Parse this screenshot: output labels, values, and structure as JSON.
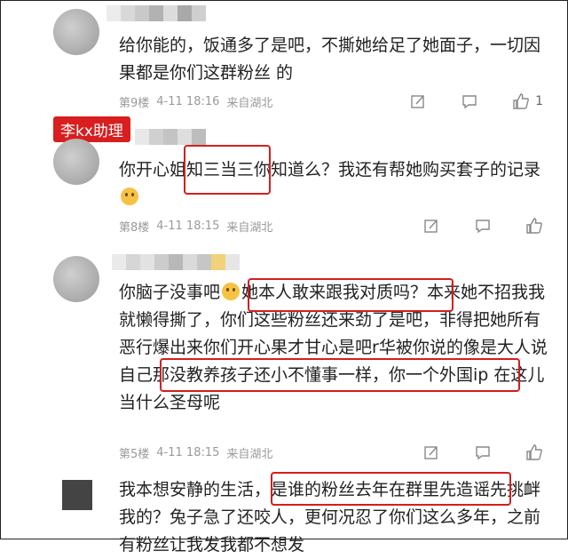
{
  "comments": [
    {
      "text": "给你能的，饭通多了是吧，不撕她给足了她面子，一切因果都是你们这群粉丝   的",
      "floor": "第9楼",
      "date": "4-11 18:16",
      "location": "来自湖北",
      "likes": "1"
    },
    {
      "tag": "李kx助理",
      "text_parts": [
        "你开心姐",
        "知三当三",
        "你知道么？我还有帮她购买套子的记录"
      ],
      "floor": "第8楼",
      "date": "4-11 18:15",
      "location": "来自湖北",
      "likes": ""
    },
    {
      "text_parts": [
        "你脑子没事吧",
        "她本人敢来跟我对质吗？",
        "本来她不招我我就懒得撕了，你们这些粉丝还来劲了是吧，非得把她所有恶行爆出来你们开心果才甘心是吧",
        "r华被你说的像是大人说自己那没教养孩子",
        "还小不懂事一样，你一个外国ip 在这儿当什么圣母呢"
      ],
      "floor": "第5楼",
      "date": "4-11 18:15",
      "location": "来自湖北",
      "likes": ""
    },
    {
      "text_parts": [
        "我本想安静的生活，",
        "是谁的粉丝去年在群里先造",
        "谣先挑衅我的？兔子急了还咬人，更何况忍了你们这么多年，之前有粉丝让我发我都不想发"
      ]
    }
  ],
  "icons": {
    "share": "share-icon",
    "comment": "comment-icon",
    "like": "thumbs-up-icon"
  },
  "colors": {
    "highlight": "#d21f1f",
    "tag_bg": "#d81e1e",
    "meta": "#9a9a9a"
  }
}
